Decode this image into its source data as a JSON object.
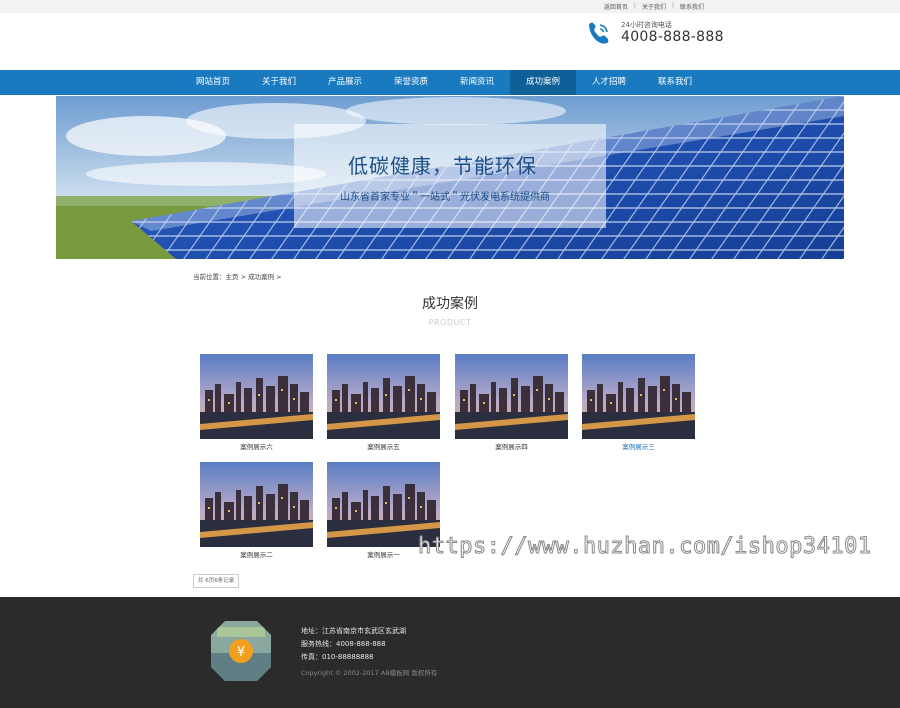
{
  "top_links": [
    "返回首页",
    "关于我们",
    "联系我们"
  ],
  "header": {
    "hotline_label": "24小时咨询电话",
    "hotline_number": "4008-888-888"
  },
  "nav": [
    "网站首页",
    "关于我们",
    "产品展示",
    "荣誉资质",
    "新闻资讯",
    "成功案例",
    "人才招聘",
    "联系我们"
  ],
  "nav_active_index": 5,
  "banner": {
    "title": "低碳健康，节能环保",
    "subtitle": "山东省首家专业＂一站式＂光伏发电系统提供商"
  },
  "breadcrumb": "当前位置：主页 > 成功案例 >",
  "section": {
    "title": "成功案例",
    "subtitle": "PRODUCT"
  },
  "cases": [
    {
      "caption": "案例展示六"
    },
    {
      "caption": "案例展示五"
    },
    {
      "caption": "案例展示四"
    },
    {
      "caption": "案例展示三"
    },
    {
      "caption": "案例展示二"
    },
    {
      "caption": "案例展示一"
    }
  ],
  "pager": "共 6页6条记录",
  "watermark": "https://www.huzhan.com/ishop34101",
  "footer": {
    "address": "地址：江苏省南京市玄武区玄武湖",
    "service": "服务热线：4008-888-888",
    "fax": "传真：010-88888888",
    "copyright": "Copyright © 2002-2017 AB模板网 版权所有"
  },
  "colors": {
    "nav_bg": "#1a7ac0",
    "nav_active": "#0f5f98",
    "footer_bg": "#2b2b2b"
  }
}
